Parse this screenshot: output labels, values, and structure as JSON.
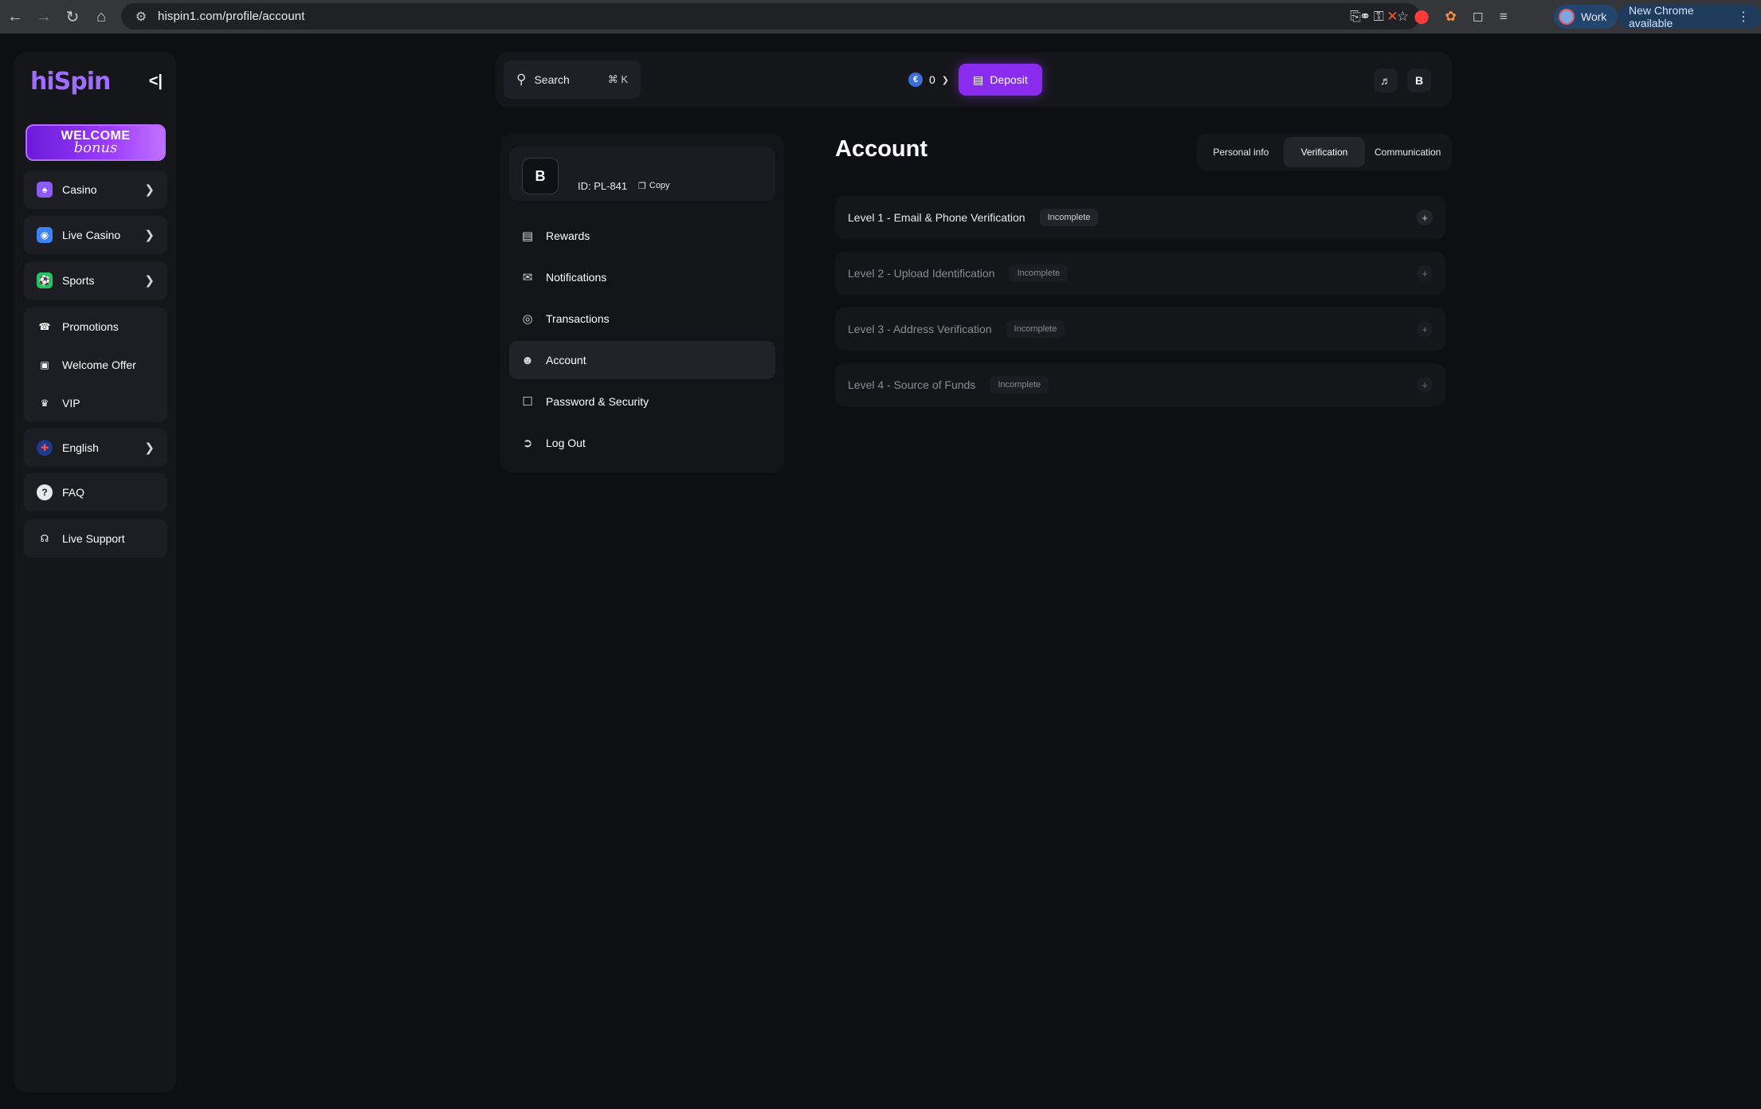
{
  "browser": {
    "url": "hispin1.com/profile/account",
    "profile_label": "Work",
    "update_label": "New Chrome available"
  },
  "sidebar": {
    "logo": "hiSpin",
    "banner": {
      "line1": "WELCOME",
      "line2": "bonus"
    },
    "group1": [
      {
        "label": "Casino",
        "icon": "casino-icon",
        "color": "#8b5cf6"
      },
      {
        "label": "Live Casino",
        "icon": "live-casino-icon",
        "color": "#3b82f6"
      },
      {
        "label": "Sports",
        "icon": "sports-icon",
        "color": "#22c55e"
      }
    ],
    "group2": [
      {
        "label": "Promotions",
        "icon": "megaphone-icon"
      },
      {
        "label": "Welcome Offer",
        "icon": "gift-icon"
      },
      {
        "label": "VIP",
        "icon": "crown-icon"
      }
    ],
    "language": "English",
    "faq": "FAQ",
    "support": "Live Support"
  },
  "header": {
    "search_label": "Search",
    "search_shortcut": "⌘ K",
    "balance": "0",
    "deposit_label": "Deposit",
    "avatar_letter": "B",
    "accent": "#8a2cf0"
  },
  "profile": {
    "avatar_letter": "B",
    "id_label": "ID: PL-841",
    "copy_label": "Copy",
    "menu": [
      {
        "label": "Rewards",
        "icon": "wallet-icon",
        "active": false
      },
      {
        "label": "Notifications",
        "icon": "inbox-icon",
        "active": false
      },
      {
        "label": "Transactions",
        "icon": "coins-icon",
        "active": false
      },
      {
        "label": "Account",
        "icon": "user-icon",
        "active": true
      },
      {
        "label": "Password & Security",
        "icon": "lock-icon",
        "active": false
      },
      {
        "label": "Log Out",
        "icon": "logout-icon",
        "active": false
      }
    ]
  },
  "account": {
    "title": "Account",
    "tabs": [
      {
        "label": "Personal info",
        "active": false
      },
      {
        "label": "Verification",
        "active": true
      },
      {
        "label": "Communication",
        "active": false
      }
    ],
    "levels": [
      {
        "title": "Level 1 - Email & Phone Verification",
        "status": "Incomplete"
      },
      {
        "title": "Level 2 - Upload Identification",
        "status": "Incomplete"
      },
      {
        "title": "Level 3 - Address Verification",
        "status": "Incomplete"
      },
      {
        "title": "Level 4 - Source of Funds",
        "status": "Incomplete"
      }
    ]
  }
}
